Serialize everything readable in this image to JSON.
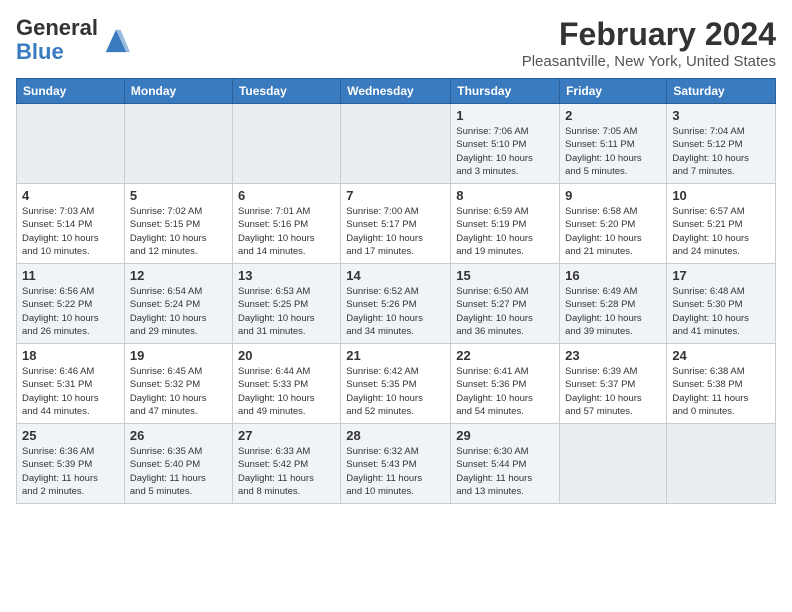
{
  "header": {
    "logo_general": "General",
    "logo_blue": "Blue",
    "month_title": "February 2024",
    "location": "Pleasantville, New York, United States"
  },
  "weekdays": [
    "Sunday",
    "Monday",
    "Tuesday",
    "Wednesday",
    "Thursday",
    "Friday",
    "Saturday"
  ],
  "weeks": [
    [
      {
        "day": "",
        "info": ""
      },
      {
        "day": "",
        "info": ""
      },
      {
        "day": "",
        "info": ""
      },
      {
        "day": "",
        "info": ""
      },
      {
        "day": "1",
        "info": "Sunrise: 7:06 AM\nSunset: 5:10 PM\nDaylight: 10 hours\nand 3 minutes."
      },
      {
        "day": "2",
        "info": "Sunrise: 7:05 AM\nSunset: 5:11 PM\nDaylight: 10 hours\nand 5 minutes."
      },
      {
        "day": "3",
        "info": "Sunrise: 7:04 AM\nSunset: 5:12 PM\nDaylight: 10 hours\nand 7 minutes."
      }
    ],
    [
      {
        "day": "4",
        "info": "Sunrise: 7:03 AM\nSunset: 5:14 PM\nDaylight: 10 hours\nand 10 minutes."
      },
      {
        "day": "5",
        "info": "Sunrise: 7:02 AM\nSunset: 5:15 PM\nDaylight: 10 hours\nand 12 minutes."
      },
      {
        "day": "6",
        "info": "Sunrise: 7:01 AM\nSunset: 5:16 PM\nDaylight: 10 hours\nand 14 minutes."
      },
      {
        "day": "7",
        "info": "Sunrise: 7:00 AM\nSunset: 5:17 PM\nDaylight: 10 hours\nand 17 minutes."
      },
      {
        "day": "8",
        "info": "Sunrise: 6:59 AM\nSunset: 5:19 PM\nDaylight: 10 hours\nand 19 minutes."
      },
      {
        "day": "9",
        "info": "Sunrise: 6:58 AM\nSunset: 5:20 PM\nDaylight: 10 hours\nand 21 minutes."
      },
      {
        "day": "10",
        "info": "Sunrise: 6:57 AM\nSunset: 5:21 PM\nDaylight: 10 hours\nand 24 minutes."
      }
    ],
    [
      {
        "day": "11",
        "info": "Sunrise: 6:56 AM\nSunset: 5:22 PM\nDaylight: 10 hours\nand 26 minutes."
      },
      {
        "day": "12",
        "info": "Sunrise: 6:54 AM\nSunset: 5:24 PM\nDaylight: 10 hours\nand 29 minutes."
      },
      {
        "day": "13",
        "info": "Sunrise: 6:53 AM\nSunset: 5:25 PM\nDaylight: 10 hours\nand 31 minutes."
      },
      {
        "day": "14",
        "info": "Sunrise: 6:52 AM\nSunset: 5:26 PM\nDaylight: 10 hours\nand 34 minutes."
      },
      {
        "day": "15",
        "info": "Sunrise: 6:50 AM\nSunset: 5:27 PM\nDaylight: 10 hours\nand 36 minutes."
      },
      {
        "day": "16",
        "info": "Sunrise: 6:49 AM\nSunset: 5:28 PM\nDaylight: 10 hours\nand 39 minutes."
      },
      {
        "day": "17",
        "info": "Sunrise: 6:48 AM\nSunset: 5:30 PM\nDaylight: 10 hours\nand 41 minutes."
      }
    ],
    [
      {
        "day": "18",
        "info": "Sunrise: 6:46 AM\nSunset: 5:31 PM\nDaylight: 10 hours\nand 44 minutes."
      },
      {
        "day": "19",
        "info": "Sunrise: 6:45 AM\nSunset: 5:32 PM\nDaylight: 10 hours\nand 47 minutes."
      },
      {
        "day": "20",
        "info": "Sunrise: 6:44 AM\nSunset: 5:33 PM\nDaylight: 10 hours\nand 49 minutes."
      },
      {
        "day": "21",
        "info": "Sunrise: 6:42 AM\nSunset: 5:35 PM\nDaylight: 10 hours\nand 52 minutes."
      },
      {
        "day": "22",
        "info": "Sunrise: 6:41 AM\nSunset: 5:36 PM\nDaylight: 10 hours\nand 54 minutes."
      },
      {
        "day": "23",
        "info": "Sunrise: 6:39 AM\nSunset: 5:37 PM\nDaylight: 10 hours\nand 57 minutes."
      },
      {
        "day": "24",
        "info": "Sunrise: 6:38 AM\nSunset: 5:38 PM\nDaylight: 11 hours\nand 0 minutes."
      }
    ],
    [
      {
        "day": "25",
        "info": "Sunrise: 6:36 AM\nSunset: 5:39 PM\nDaylight: 11 hours\nand 2 minutes."
      },
      {
        "day": "26",
        "info": "Sunrise: 6:35 AM\nSunset: 5:40 PM\nDaylight: 11 hours\nand 5 minutes."
      },
      {
        "day": "27",
        "info": "Sunrise: 6:33 AM\nSunset: 5:42 PM\nDaylight: 11 hours\nand 8 minutes."
      },
      {
        "day": "28",
        "info": "Sunrise: 6:32 AM\nSunset: 5:43 PM\nDaylight: 11 hours\nand 10 minutes."
      },
      {
        "day": "29",
        "info": "Sunrise: 6:30 AM\nSunset: 5:44 PM\nDaylight: 11 hours\nand 13 minutes."
      },
      {
        "day": "",
        "info": ""
      },
      {
        "day": "",
        "info": ""
      }
    ]
  ]
}
